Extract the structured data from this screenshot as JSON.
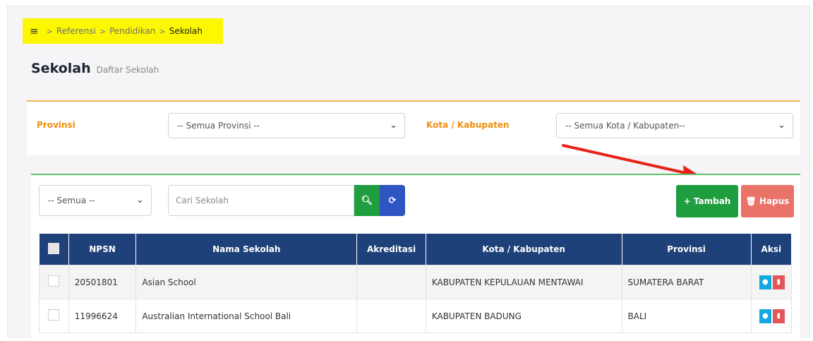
{
  "breadcrumb": {
    "menu_icon": "hamburger-menu-icon",
    "separator": ">",
    "items": [
      "Referensi",
      "Pendidikan",
      "Sekolah"
    ]
  },
  "header": {
    "title": "Sekolah",
    "subtitle": "Daftar Sekolah"
  },
  "filters": {
    "provinsi_label": "Provinsi",
    "provinsi_value": "-- Semua Provinsi --",
    "kota_label": "Kota / Kabupaten",
    "kota_value": "-- Semua Kota / Kabupaten--"
  },
  "toolbar": {
    "filter_value": "-- Semua --",
    "search_placeholder": "Cari Sekolah",
    "search_icon": "search-icon",
    "refresh_icon": "refresh-icon",
    "add_label": "+ Tambah",
    "delete_label": "Hapus"
  },
  "table": {
    "columns": [
      "NPSN",
      "Nama Sekolah",
      "Akreditasi",
      "Kota / Kabupaten",
      "Provinsi",
      "Aksi"
    ],
    "rows": [
      {
        "npsn": "20501801",
        "nama": "Asian School",
        "akreditasi": "",
        "kota": "KABUPATEN KEPULAUAN MENTAWAI",
        "provinsi": "SUMATERA BARAT"
      },
      {
        "npsn": "11996624",
        "nama": "Australian International School Bali",
        "akreditasi": "",
        "kota": "KABUPATEN BADUNG",
        "provinsi": "BALI"
      }
    ]
  },
  "colors": {
    "breadcrumb_highlight": "#fdf800",
    "table_header": "#1f4179",
    "filter_accent": "#ee8f0d",
    "add_button": "#1e9e3e",
    "delete_button": "#e97269",
    "search_button": "#1e9e3e",
    "refresh_button": "#2f55c3",
    "arrow": "#e8231b"
  }
}
